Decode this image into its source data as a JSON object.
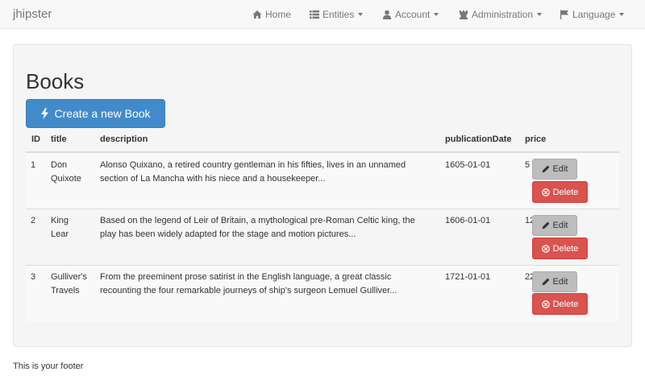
{
  "navbar": {
    "brand": "jhipster",
    "items": [
      {
        "label": "Home",
        "icon": "home-icon",
        "dropdown": false
      },
      {
        "label": "Entities",
        "icon": "list-icon",
        "dropdown": true
      },
      {
        "label": "Account",
        "icon": "user-icon",
        "dropdown": true
      },
      {
        "label": "Administration",
        "icon": "tower-icon",
        "dropdown": true
      },
      {
        "label": "Language",
        "icon": "flag-icon",
        "dropdown": true
      }
    ]
  },
  "page": {
    "title": "Books",
    "create_button": "Create a new Book"
  },
  "table": {
    "headers": [
      "ID",
      "title",
      "description",
      "publicationDate",
      "price"
    ],
    "rows": [
      {
        "id": "1",
        "title_lines": [
          "Don",
          "Quixote"
        ],
        "description_lines": [
          "Alonso Quixano, a retired country gentleman in his fifties, lives in an unnamed",
          "section of La Mancha with his niece and a housekeeper..."
        ],
        "publicationDate": "1605-01-01",
        "price": "5"
      },
      {
        "id": "2",
        "title_lines": [
          "King",
          "Lear"
        ],
        "description_lines": [
          "Based on the legend of Leir of Britain, a mythological pre-Roman Celtic king, the",
          "play has been widely adapted for the stage and motion pictures..."
        ],
        "publicationDate": "1606-01-01",
        "price": "12"
      },
      {
        "id": "3",
        "title_lines": [
          "Gulliver's",
          "Travels"
        ],
        "description_lines": [
          "From the preeminent prose satirist in the English language, a great classic",
          "recounting the four remarkable journeys of ship's surgeon Lemuel Gulliver..."
        ],
        "publicationDate": "1721-01-01",
        "price": "22"
      }
    ],
    "edit_label": "Edit",
    "delete_label": "Delete"
  },
  "footer": {
    "text": "This is your footer"
  },
  "colors": {
    "primary": "#428bca",
    "danger": "#d9534f",
    "edit_button": "#bdbdbd"
  }
}
